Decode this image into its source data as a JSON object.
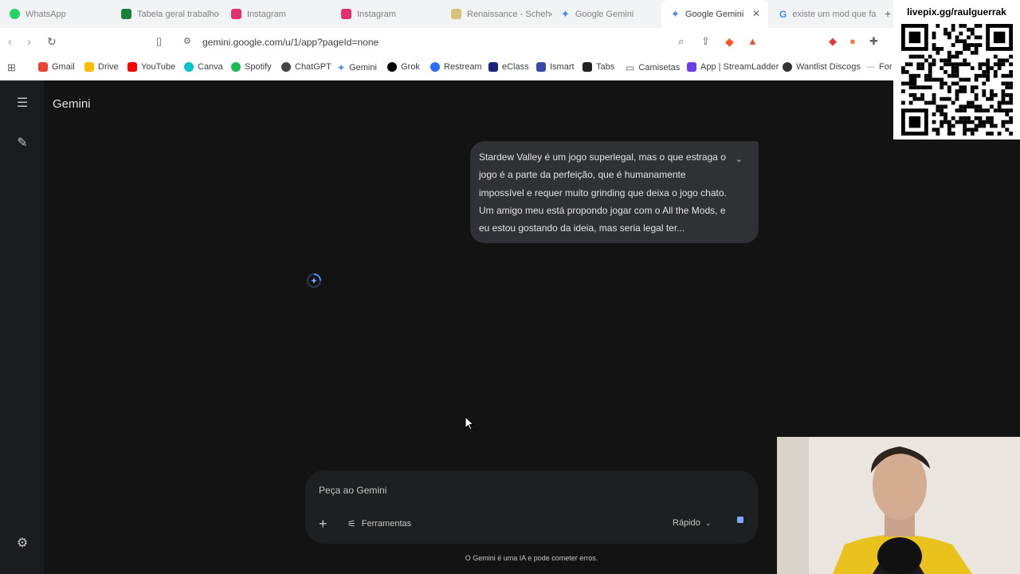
{
  "tabs": [
    {
      "label": "WhatsApp",
      "color": "#25d366"
    },
    {
      "label": "Tabela geral trabalho",
      "color": "#188038"
    },
    {
      "label": "Instagram",
      "color": "#e1306c"
    },
    {
      "label": "Instagram",
      "color": "#e1306c"
    },
    {
      "label": "Renaissance - Schehe",
      "color": "#d6c27a"
    },
    {
      "label": "Google Gemini",
      "color": "#4285f4"
    },
    {
      "label": "Google Gemini",
      "color": "#4285f4"
    },
    {
      "label": "existe um mod que fa",
      "color": "#4285f4"
    }
  ],
  "address_bar": {
    "url": "gemini.google.com/u/1/app?pageId=none"
  },
  "bookmarks": [
    {
      "label": "Gmail",
      "color": "#ea4335"
    },
    {
      "label": "Drive",
      "color": "#fbbc04"
    },
    {
      "label": "YouTube",
      "color": "#ff0000"
    },
    {
      "label": "Canva",
      "color": "#00c4cc"
    },
    {
      "label": "Spotify",
      "color": "#1db954"
    },
    {
      "label": "ChatGPT",
      "color": "#444444"
    },
    {
      "label": "Gemini",
      "color": "#4285f4"
    },
    {
      "label": "Grok",
      "color": "#000000"
    },
    {
      "label": "Restream",
      "color": "#2f6bff"
    },
    {
      "label": "eClass",
      "color": "#1a237e"
    },
    {
      "label": "Ismart",
      "color": "#3949ab"
    },
    {
      "label": "Tabs",
      "color": "#222222"
    },
    {
      "label": "Camisetas",
      "color": "#9e9e9e"
    },
    {
      "label": "App | StreamLadder",
      "color": "#6a3de8"
    },
    {
      "label": "Wantlist Discogs",
      "color": "#333333"
    },
    {
      "label": "For",
      "color": "#9e9e9e"
    }
  ],
  "app": {
    "title": "Gemini"
  },
  "chat": {
    "user_message": "Stardew Valley é um jogo superlegal, mas o que estraga o jogo é a parte da perfeição, que é humanamente impossível e requer muito grinding que deixa o jogo chato. Um amigo meu está propondo jogar com o All the Mods, e eu estou gostando da ideia, mas seria legal ter..."
  },
  "input": {
    "placeholder": "Peça ao Gemini",
    "tools_label": "Ferramentas",
    "mode_label": "Rápido"
  },
  "disclaimer": "O Gemini é uma IA e pode cometer erros.",
  "overlay": {
    "qr_label": "livepix.gg/raulguerrak"
  }
}
